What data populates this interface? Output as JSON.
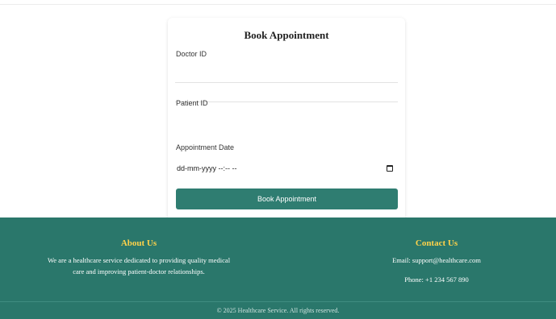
{
  "form": {
    "title": "Book Appointment",
    "doctor_id_label": "Doctor ID",
    "doctor_id_value": "",
    "patient_id_label": "Patient ID",
    "patient_id_value": "",
    "date_label": "Appointment Date",
    "date_placeholder": "dd-mm-yyyy --:-- --",
    "submit_label": "Book Appointment"
  },
  "footer": {
    "about_heading": "About Us",
    "about_line1": "We are a healthcare service dedicated to providing quality medical",
    "about_line2": "care and improving patient-doctor relationships.",
    "contact_heading": "Contact Us",
    "contact_email": "Email: support@healthcare.com",
    "contact_phone": "Phone: +1 234 567 890",
    "copyright": "© 2025 Healthcare Service. All rights reserved."
  },
  "colors": {
    "primary": "#2f7d71",
    "footer_bg": "#2a776b",
    "footer_heading": "#ffd24a"
  }
}
